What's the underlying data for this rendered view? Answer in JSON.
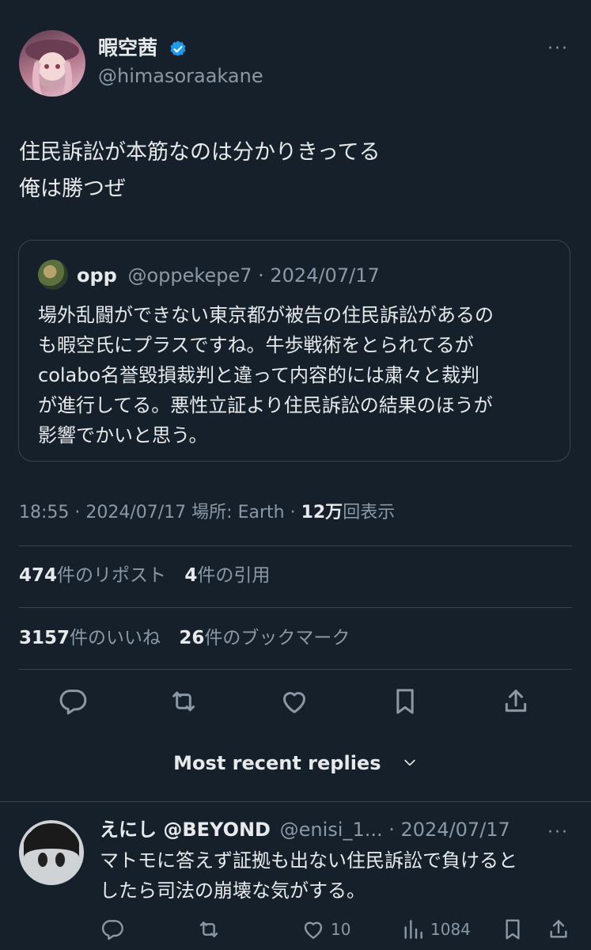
{
  "tweet": {
    "display_name": "暇空茜",
    "handle": "@himasoraakane",
    "more_label": "···",
    "body_lines": [
      "住民訴訟が本筋なのは分かりきってる",
      "俺は勝つぜ"
    ],
    "quote": {
      "name": "opp",
      "handle_date": "@oppekepe7 · 2024/07/17",
      "lines": [
        "場外乱闘ができない東京都が被告の住民訴訟があるの",
        "も暇空氏にプラスですね。牛歩戦術をとられてるが",
        "colabo名誉毀損裁判と違って内容的には粛々と裁判",
        "が進行してる。悪性立証より住民訴訟の結果のほうが",
        "影響でかいと思う。"
      ]
    },
    "meta": {
      "time_date": "18:55 · 2024/07/17 場所: Earth · ",
      "views_count": "12万",
      "views_label": "回表示"
    },
    "stats": {
      "reposts_count": "474",
      "reposts_label": "件のリポスト",
      "quotes_count": "4",
      "quotes_label": "件の引用",
      "likes_count": "3157",
      "likes_label": "件のいいね",
      "bookmarks_count": "26",
      "bookmarks_label": "件のブックマーク"
    }
  },
  "replies_sort_label": "Most recent replies",
  "reply": {
    "name": "えにし @BEYOND",
    "handle_date": "@enisi_1... · 2024/07/17",
    "more_label": "···",
    "lines": [
      "マトモに答えず証拠も出ない住民訴訟で負けると",
      "したら司法の崩壊な気がする。"
    ],
    "like_count": "10",
    "views_count": "1084"
  },
  "colors": {
    "background": "#15202b",
    "text": "#e7e9ea",
    "muted": "#8b98a5",
    "border": "#38444d",
    "verified": "#1d9bf0"
  }
}
